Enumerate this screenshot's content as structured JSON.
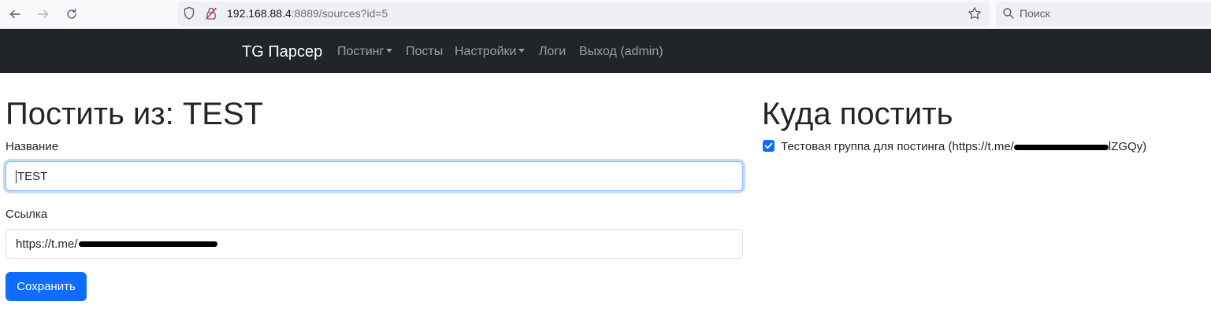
{
  "browser": {
    "url_host": "192.168.88.4",
    "url_rest": ":8889/sources?id=5",
    "search_placeholder": "Поиск"
  },
  "navbar": {
    "brand": "TG Парсер",
    "items": [
      {
        "label": "Постинг",
        "dropdown": true
      },
      {
        "label": "Посты",
        "dropdown": false
      },
      {
        "label": "Настройки",
        "dropdown": true
      },
      {
        "label": "Логи",
        "dropdown": false
      },
      {
        "label": "Выход (admin)",
        "dropdown": false
      }
    ]
  },
  "form": {
    "heading": "Постить из: TEST",
    "name_label": "Название",
    "name_value": "TEST",
    "link_label": "Ссылка",
    "link_value_prefix": "https://t.me/",
    "save_label": "Сохранить"
  },
  "targets": {
    "heading": "Куда постить",
    "items": [
      {
        "label_prefix": "Тестовая группа для постинга (https://t.me/",
        "label_suffix": "lZGQy)",
        "checked": true
      }
    ]
  },
  "colors": {
    "primary": "#0d6efd",
    "navbar_bg": "#212529"
  }
}
